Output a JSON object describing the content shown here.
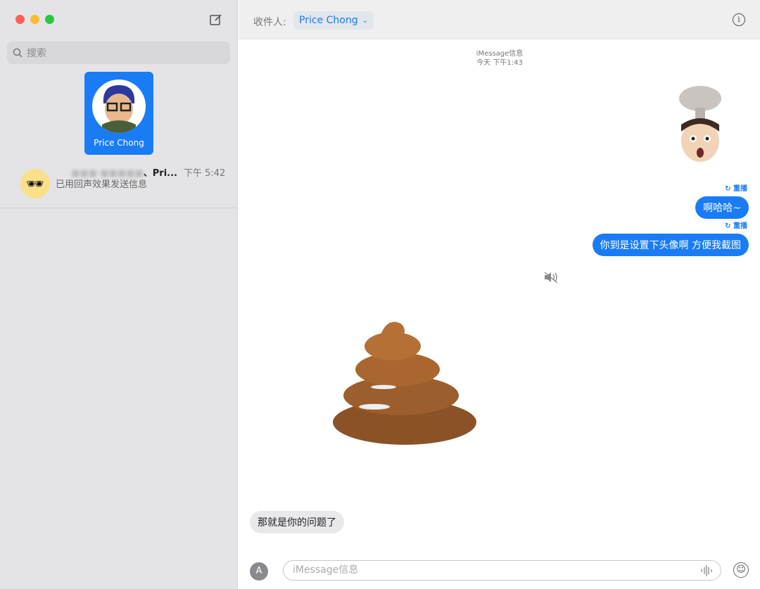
{
  "window": {
    "traffic_lights": [
      "#fe5f57",
      "#febc2e",
      "#28c840"
    ]
  },
  "sidebar": {
    "search_placeholder": "搜索",
    "pinned": {
      "name": "Price Chong",
      "accent": "#1a7cf5"
    },
    "conversations": [
      {
        "name_visible": "、Pri...",
        "time": "下午 5:42",
        "preview": "已用回声效果发送信息",
        "avatar": "glasses-emoji"
      }
    ]
  },
  "header": {
    "to_label": "收件人:",
    "recipient": "Price Chong"
  },
  "chat": {
    "service": "iMessage信息",
    "timestamp": "今天 下午1:43",
    "replay_label": "重播",
    "messages": [
      {
        "from": "me",
        "type": "memoji",
        "desc": "mind-blown memoji"
      },
      {
        "from": "me",
        "text": "啊哈哈~"
      },
      {
        "from": "me",
        "text": "你到是设置下头像啊 方便我截图"
      },
      {
        "from": "them",
        "type": "animoji",
        "desc": "poop animoji"
      },
      {
        "from": "them",
        "text": "那就是你的问题了"
      }
    ]
  },
  "footer": {
    "input_placeholder": "iMessage信息"
  }
}
